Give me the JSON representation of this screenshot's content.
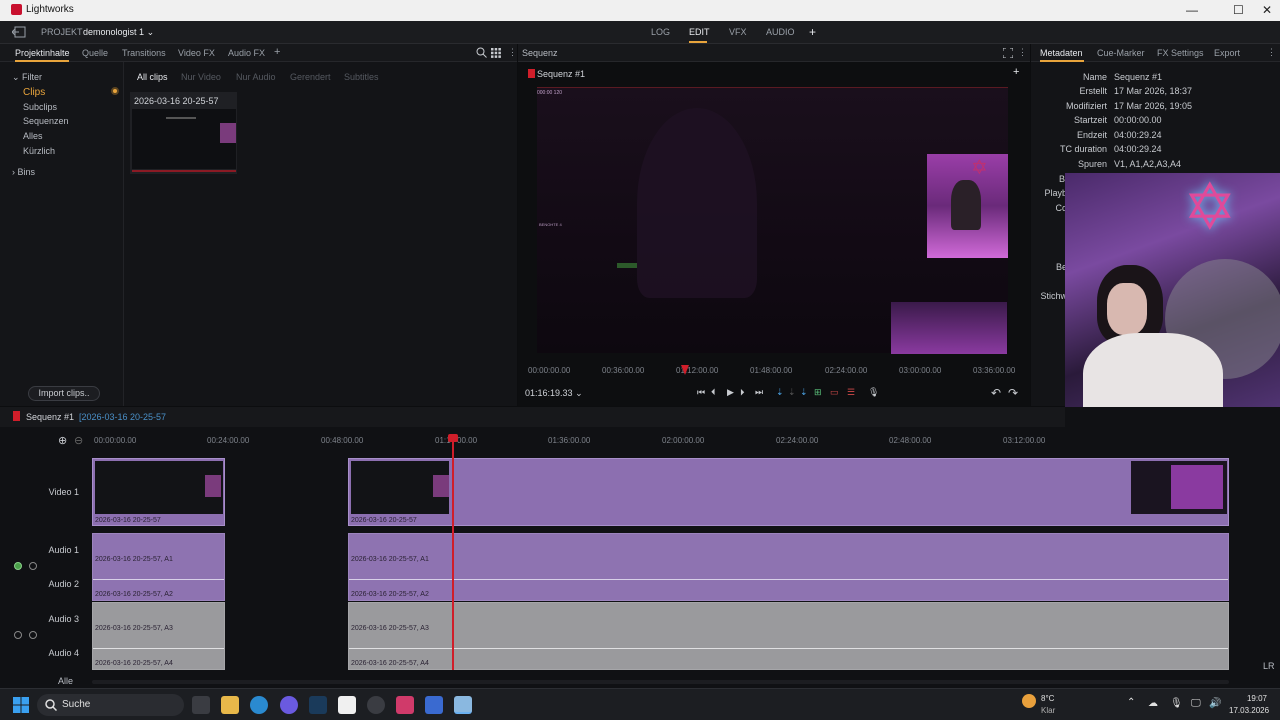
{
  "window": {
    "title": "Lightworks",
    "minimize": "—",
    "maximize": "☐",
    "close": "✕"
  },
  "appbar": {
    "project_prefix": "PROJEKT",
    "project_name": "demonologist 1",
    "tabs": [
      "LOG",
      "EDIT",
      "VFX",
      "AUDIO"
    ],
    "active_tab": "EDIT",
    "add": "+"
  },
  "library": {
    "tabs": [
      "Projektinhalte",
      "Quelle",
      "Transitions",
      "Video FX",
      "Audio FX"
    ],
    "add": "+",
    "tree": {
      "filter": "Filter",
      "items": [
        "Clips",
        "Subclips",
        "Sequenzen",
        "Alles",
        "Kürzlich"
      ],
      "bins": "Bins"
    },
    "subtabs": [
      "All clips",
      "Nur Video",
      "Nur Audio",
      "Gerendert",
      "Subtitles"
    ],
    "clip_name": "2026-03-16 20-25-57",
    "import_label": "Import clips.."
  },
  "viewer": {
    "header": "Sequenz",
    "seq_title": "Sequenz #1",
    "add": "+",
    "ruler": [
      "00:00:00.00",
      "00:36:00.00",
      "01:12:00.00",
      "01:48:00.00",
      "02:24:00.00",
      "03:00:00.00",
      "03:36:00.00"
    ],
    "playhead_fraction": 0.33,
    "timecode": "01:16:19.33",
    "overlay_tl": "000:00  120",
    "overlay_mid": "BENOHTE 4"
  },
  "metadata": {
    "tabs": [
      "Metadaten",
      "Cue-Marker",
      "FX Settings",
      "Export"
    ],
    "rows": [
      {
        "k": "Name",
        "v": "Sequenz #1"
      },
      {
        "k": "Erstellt",
        "v": "17 Mar 2026, 18:37"
      },
      {
        "k": "Modifiziert",
        "v": "17 Mar 2026, 19:05"
      },
      {
        "k": "Startzeit",
        "v": "00:00:00.00"
      },
      {
        "k": "Endzeit",
        "v": "04:00:29.24"
      },
      {
        "k": "TC duration",
        "v": "04:00:29.24"
      },
      {
        "k": "Spuren",
        "v": "V1, A1,A2,A3,A4"
      }
    ],
    "partial": [
      "Bi",
      "Playb",
      "Co",
      "Be",
      "Stichw"
    ]
  },
  "timeline": {
    "seq_label": "Sequenz #1",
    "seq_source": "[2026-03-16 20-25-57",
    "ruler": [
      "00:00:00.00",
      "00:24:00.00",
      "00:48:00.00",
      "01:1",
      "00.00",
      "01:36:00.00",
      "02:00:00.00",
      "02:24:00.00",
      "02:48:00.00",
      "03:12:00.00"
    ],
    "tracks": [
      "Video 1",
      "Audio 1",
      "Audio 2",
      "Audio 3",
      "Audio 4"
    ],
    "clip_v": "2026-03-16 20-25-57",
    "clip_a1": "2026-03-16 20-25-57, A1",
    "clip_a2": "2026-03-16 20-25-57, A2",
    "clip_a3": "2026-03-16 20-25-57, A3",
    "clip_a4": "2026-03-16 20-25-57, A4",
    "all_label": "Alle",
    "lr_label": "LR"
  },
  "taskbar": {
    "search": "Suche",
    "weather_temp": "8°C",
    "weather_cond": "Klar",
    "time": "19:07",
    "date": "17.03.2026"
  },
  "colors": {
    "accent": "#e8a43c",
    "playhead": "#d01e2a",
    "clip_purple": "#8c6fb0",
    "clip_gray": "#9a9a9d"
  }
}
